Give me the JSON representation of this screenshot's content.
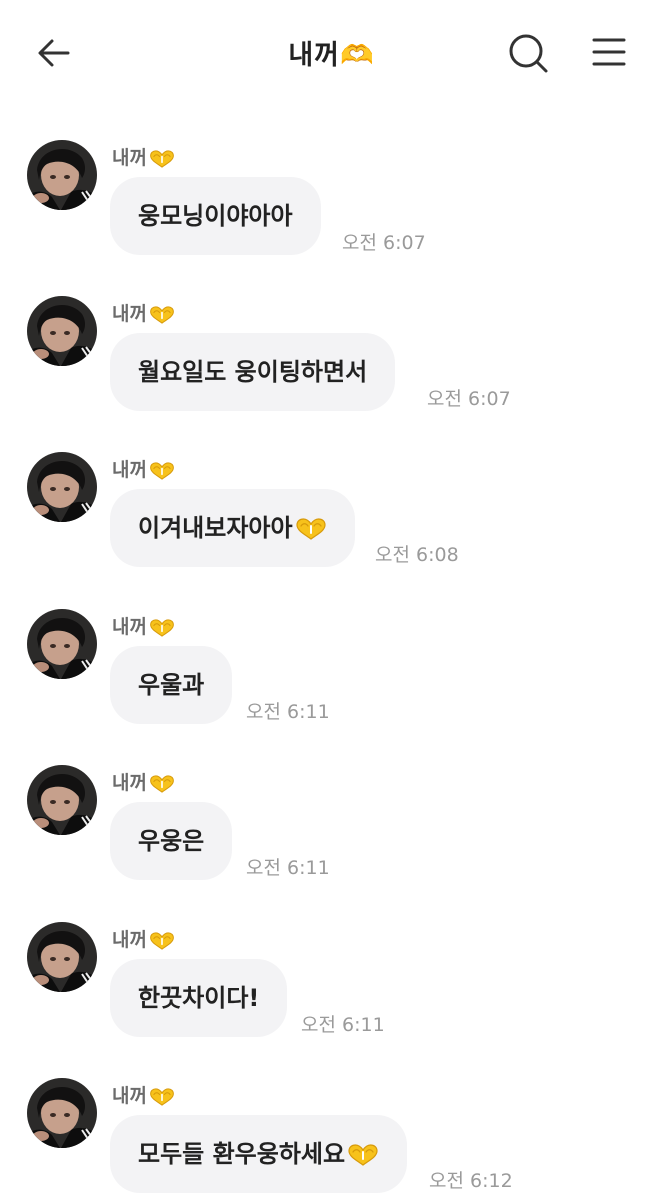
{
  "header": {
    "back_icon": "back-arrow-icon",
    "title": "내꺼🫶",
    "search_icon": "search-icon",
    "menu_icon": "menu-icon"
  },
  "colors": {
    "bubble": "#f3f3f5",
    "timestamp": "#9a9a9a",
    "sender": "#6b6b6b",
    "heart": "#f7c21b"
  },
  "messages": [
    {
      "sender": "내꺼",
      "text": "웅모닝이야아아",
      "time": "오전 6:07",
      "emoji": false
    },
    {
      "sender": "내꺼",
      "text": "월요일도 웅이팅하면서",
      "time": "오전 6:07",
      "emoji": false
    },
    {
      "sender": "내꺼",
      "text": "이겨내보자아아",
      "time": "오전 6:08",
      "emoji": true
    },
    {
      "sender": "내꺼",
      "text": "우울과",
      "time": "오전 6:11",
      "emoji": false
    },
    {
      "sender": "내꺼",
      "text": "우웅은",
      "time": "오전 6:11",
      "emoji": false
    },
    {
      "sender": "내꺼",
      "text": "한끗차이다!",
      "time": "오전 6:11",
      "emoji": false
    },
    {
      "sender": "내꺼",
      "text": "모두들 환우웅하세요",
      "time": "오전 6:12",
      "emoji": true
    }
  ]
}
